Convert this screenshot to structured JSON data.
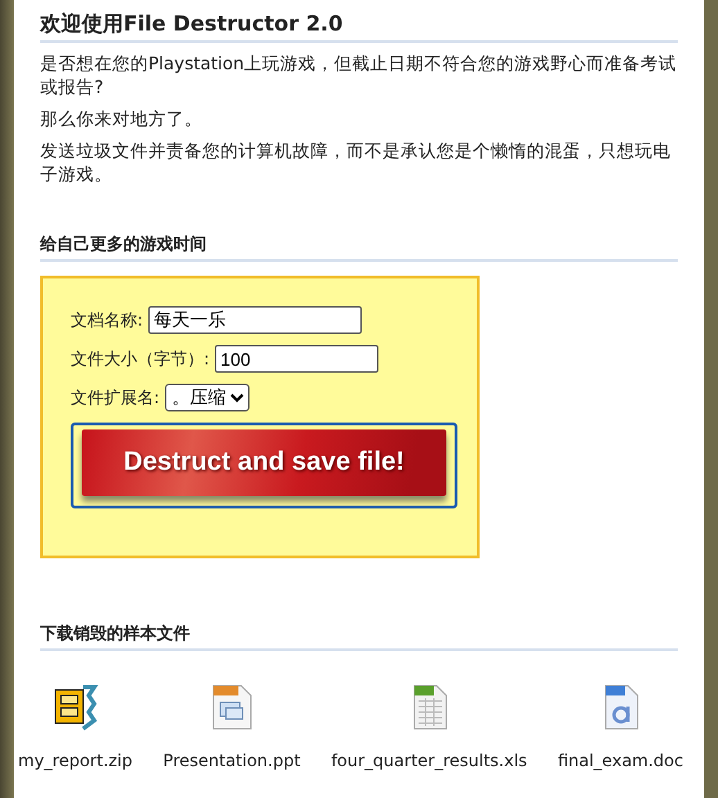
{
  "title": "欢迎使用File Destructor 2.0",
  "paragraphs": [
    "是否想在您的Playstation上玩游戏，但截止日期不符合您的游戏野心而准备考试或报告?",
    "那么你来对地方了。",
    "发送垃圾文件并责备您的计算机故障，而不是承认您是个懒惰的混蛋，只想玩电子游戏。"
  ],
  "form_section": {
    "heading": "给自己更多的游戏时间",
    "fields": [
      {
        "kind": "text",
        "label": "文档名称:",
        "value": "每天一乐"
      },
      {
        "kind": "number",
        "label": "文件大小（字节）:",
        "value": "100"
      },
      {
        "kind": "select",
        "label": "文件扩展名:",
        "value": "。压缩"
      }
    ],
    "button": "Destruct and save file!"
  },
  "downloads": {
    "heading": "下载销毁的样本文件",
    "files": [
      {
        "kind": "zip",
        "name": "my_report.zip"
      },
      {
        "kind": "ppt",
        "name": "Presentation.ppt"
      },
      {
        "kind": "xls",
        "name": "four_quarter_results.xls"
      },
      {
        "kind": "doc",
        "name": "final_exam.doc"
      }
    ]
  }
}
